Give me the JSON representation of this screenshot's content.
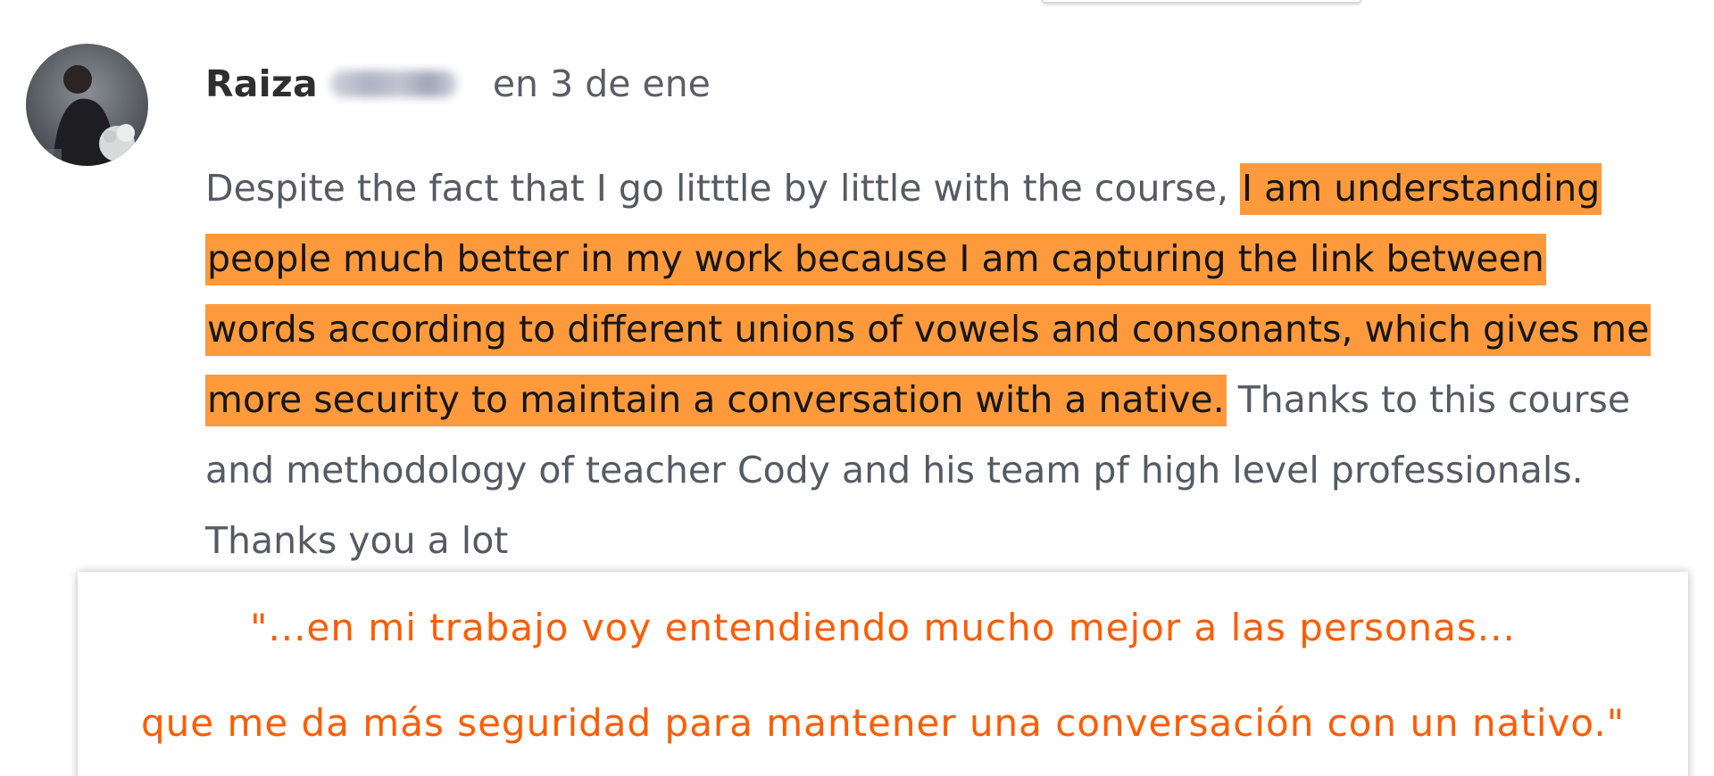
{
  "comment": {
    "author_first_name": "Raiza",
    "author_last_name": "Ibarra",
    "date": "en 3 de ene",
    "lines": [
      {
        "plain": "Despite the fact that I go litttle by little with the course, ",
        "highlight": "I am understanding",
        "after": ""
      },
      {
        "plain": "",
        "highlight": "people much better in my work because I am capturing the link between",
        "after": ""
      },
      {
        "plain": "",
        "highlight": "words according to different unions of vowels and consonants, which gives me",
        "after": ""
      },
      {
        "plain": "",
        "highlight": "more security to maintain a conversation with a native.",
        "after": " Thanks to this course"
      },
      {
        "plain": "and methodology of teacher Cody and his team pf high level professionals.",
        "highlight": "",
        "after": ""
      },
      {
        "plain": "Thanks you a lot",
        "highlight": "",
        "after": ""
      }
    ]
  },
  "quote": {
    "line1": "\"...en mi trabajo voy entendiendo mucho mejor a las personas...",
    "line2": "que me da más seguridad para mantener una conversación con un nativo.\""
  },
  "colors": {
    "highlight": "#ff9a3c",
    "quote_text": "#ff5c00",
    "body_text": "#555a63",
    "author_text": "#2e2e2e"
  },
  "icons": {
    "avatar": "user-avatar-photo"
  }
}
